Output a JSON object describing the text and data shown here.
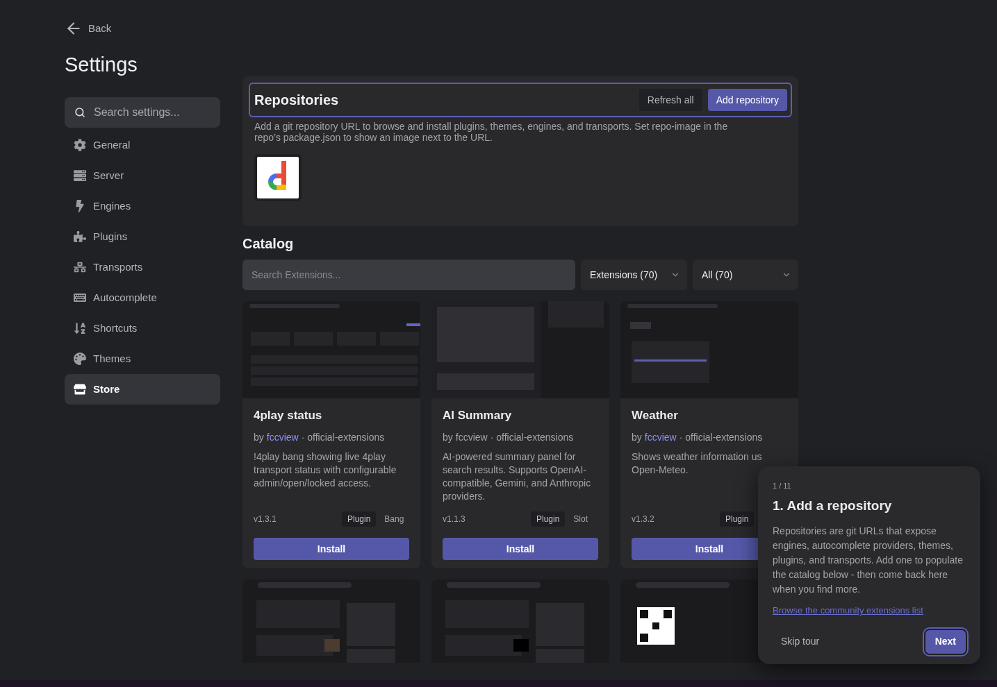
{
  "back": {
    "label": "Back"
  },
  "title": "Settings",
  "sidebar": {
    "search": {
      "placeholder": "Search settings..."
    },
    "items": [
      {
        "label": "General",
        "selected": false
      },
      {
        "label": "Server",
        "selected": false
      },
      {
        "label": "Engines",
        "selected": false
      },
      {
        "label": "Plugins",
        "selected": false
      },
      {
        "label": "Transports",
        "selected": false
      },
      {
        "label": "Autocomplete",
        "selected": false
      },
      {
        "label": "Shortcuts",
        "selected": false
      },
      {
        "label": "Themes",
        "selected": false
      },
      {
        "label": "Store",
        "selected": true
      }
    ]
  },
  "repositories": {
    "title": "Repositories",
    "buttons": [
      {
        "label": "Refresh all",
        "kind": "secondary"
      },
      {
        "label": "Add repository",
        "kind": "primary"
      }
    ],
    "description": "Add a git repository URL to browse and install plugins, themes, engines, and transports. Set repo-image in the repo’s package.json to show an image next to the URL."
  },
  "catalog": {
    "title": "Catalog",
    "search": {
      "placeholder": "Search Extensions..."
    },
    "filters": [
      {
        "label": "Extensions (70)"
      },
      {
        "label": "All (70)"
      }
    ],
    "cards": [
      {
        "name": "4play status",
        "by": "by",
        "author": "fccview",
        "author_linked": true,
        "source": "· official-extensions",
        "description": "!4play bang showing live 4play transport status with configurable admin/open/locked access.",
        "version": "v1.3.1",
        "tags": [
          {
            "label": "Plugin",
            "kind": "type"
          },
          {
            "label": "Bang",
            "kind": "category"
          }
        ],
        "button": "Install"
      },
      {
        "name": "AI Summary",
        "by": "by",
        "author": "fccview",
        "author_linked": false,
        "source": "· official-extensions",
        "description": "AI-powered summary panel for search results. Supports OpenAI-compatible, Gemini, and Anthropic providers.",
        "version": "v1.1.3",
        "tags": [
          {
            "label": "Plugin",
            "kind": "type"
          },
          {
            "label": "Slot",
            "kind": "category"
          }
        ],
        "button": "Install"
      },
      {
        "name": "Weather",
        "by": "by",
        "author": "fccview",
        "author_linked": true,
        "source": "· official-extensions",
        "description": "Shows weather information us\nOpen-Meteo.",
        "version": "v1.3.2",
        "tags": [
          {
            "label": "Plugin",
            "kind": "type"
          }
        ],
        "button": "Install"
      }
    ]
  },
  "tour": {
    "step": "1 / 11",
    "title": "1. Add a repository",
    "body": "Repositories are git URLs that expose engines, autocomplete providers, themes, plugins, and transports. Add one to populate the catalog below - then come back here when you find more.",
    "link": "Browse the community extensions list",
    "skip": "Skip tour",
    "next": "Next"
  }
}
